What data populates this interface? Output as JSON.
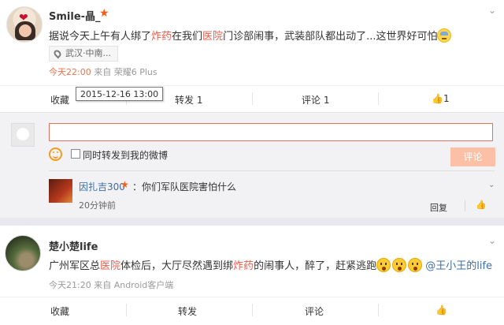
{
  "post1": {
    "username": "Smile-晶_",
    "content_parts": [
      {
        "text": "据说今天上午有人绑了",
        "hl": false
      },
      {
        "text": "炸药",
        "hl": true
      },
      {
        "text": "在我们",
        "hl": false
      },
      {
        "text": "医院",
        "hl": true
      },
      {
        "text": "门诊部闹事，武装部队都出动了...这世界好可怕",
        "hl": false
      }
    ],
    "location": "武汉·中南...",
    "time": "今天22:00",
    "source": "来自 荣耀6 Plus",
    "tooltip": "2015-12-16 13:00",
    "actions": {
      "favorite": "收藏",
      "repost": "转发 1",
      "comment": "评论 1",
      "like": "1"
    },
    "comment_box": {
      "input_value": "",
      "also_repost_label": "同时转发到我的微博",
      "submit_label": "评论"
    },
    "reply": {
      "name": "因扎吉300",
      "text": "：你们军队医院害怕什么",
      "time": "20分钟前",
      "reply_label": "回复"
    }
  },
  "post2": {
    "username": "楚小楚life",
    "content_parts": [
      {
        "text": "广州军区总",
        "hl": false
      },
      {
        "text": "医院",
        "hl": true
      },
      {
        "text": "体检后，大厅尽然遇到绑",
        "hl": false
      },
      {
        "text": "炸药",
        "hl": true
      },
      {
        "text": "的闹事人，醉了，赶紧逃跑",
        "hl": false
      }
    ],
    "mention": "@王小王的life",
    "time": "今天21:20",
    "source": "来自 Android客户端",
    "actions": {
      "favorite": "收藏",
      "repost": "转发",
      "comment": "评论",
      "like": ""
    }
  },
  "icons": {
    "chevron": "chevron-down-icon",
    "star": "star-icon",
    "thumb": "thumb-up-icon",
    "pin": "location-pin-icon",
    "smiley": "smiley-icon"
  },
  "colors": {
    "highlight": "#eb5b4b",
    "link": "#3b6ea5",
    "time": "#eb7350",
    "button": "#fbc0a6"
  }
}
